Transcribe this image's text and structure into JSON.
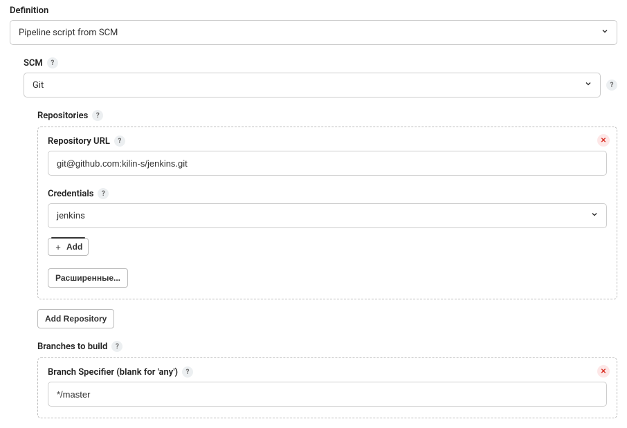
{
  "definition": {
    "label": "Definition",
    "value": "Pipeline script from SCM"
  },
  "scm": {
    "label": "SCM",
    "value": "Git"
  },
  "repositories": {
    "label": "Repositories",
    "repo": {
      "url_label": "Repository URL",
      "url_value": "git@github.com:kilin-s/jenkins.git",
      "credentials_label": "Credentials",
      "credentials_value": "jenkins",
      "add_label": "Add",
      "advanced_label": "Расширенные..."
    },
    "add_repo_label": "Add Repository"
  },
  "branches": {
    "label": "Branches to build",
    "specifier_label": "Branch Specifier (blank for 'any')",
    "specifier_value": "*/master"
  }
}
